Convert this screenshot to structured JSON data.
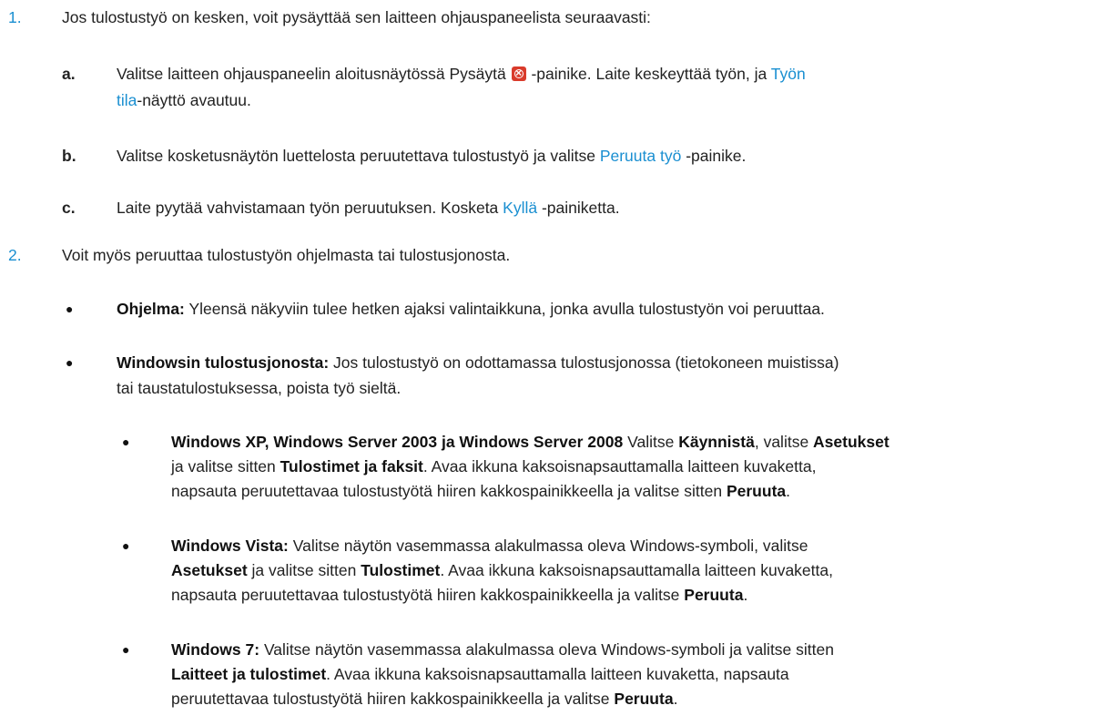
{
  "steps": [
    {
      "num": "1.",
      "text": "Jos tulostustyö on kesken, voit pysäyttää sen laitteen ohjauspaneelista seuraavasti:",
      "substeps": [
        {
          "letter": "a.",
          "line1_before": "Valitse laitteen ohjauspaneelin aloitusnäytössä Pysäytä",
          "icon": "stop-icon",
          "line1_after": "-painike. Laite keskeyttää työn, ja",
          "line1_link": "Työn",
          "line2_link": "tila",
          "line2_after": "-näyttö avautuu."
        },
        {
          "letter": "b.",
          "before": "Valitse kosketusnäytön luettelosta peruutettava tulostustyö ja valitse",
          "link": "Peruuta työ",
          "after": "-painike."
        },
        {
          "letter": "c.",
          "before": "Laite pyytää vahvistamaan työn peruutuksen. Kosketa",
          "link": "Kyllä",
          "after": "-painiketta."
        }
      ]
    },
    {
      "num": "2.",
      "text": "Voit myös peruuttaa tulostustyön ohjelmasta tai tulostusjonosta.",
      "bullets": [
        {
          "bold": "Ohjelma:",
          "text": "Yleensä näkyviin tulee hetken ajaksi valintaikkuna, jonka avulla tulostustyön voi peruuttaa."
        },
        {
          "bold": "Windowsin tulostusjonosta:",
          "line1": "Jos tulostustyö on odottamassa tulostusjonossa (tietokoneen muistissa)",
          "line2": "tai taustatulostuksessa, poista työ sieltä.",
          "subbullets": [
            {
              "bold": "Windows XP, Windows Server 2003 ja Windows Server 2008",
              "t1": "Valitse",
              "b1": "Käynnistä",
              "t2": ", valitse",
              "b2": "Asetukset",
              "t3": "ja valitse sitten",
              "b3": "Tulostimet ja faksit",
              "t4": ". Avaa ikkuna kaksoisnapsauttamalla laitteen kuvaketta,",
              "line3_before": "napsauta peruutettavaa tulostustyötä hiiren kakkospainikkeella ja valitse sitten",
              "line3_bold": "Peruuta",
              "line3_after": "."
            },
            {
              "bold": "Windows Vista:",
              "line1": "Valitse näytön vasemmassa alakulmassa oleva Windows-symboli, valitse",
              "l2_b1": "Asetukset",
              "l2_t1": "ja valitse sitten",
              "l2_b2": "Tulostimet",
              "l2_t2": ". Avaa ikkuna kaksoisnapsauttamalla laitteen kuvaketta,",
              "line3_before": "napsauta peruutettavaa tulostustyötä hiiren kakkospainikkeella ja valitse",
              "line3_bold": "Peruuta",
              "line3_after": "."
            },
            {
              "bold": "Windows 7:",
              "line1": "Valitse näytön vasemmassa alakulmassa oleva Windows-symboli ja valitse sitten",
              "l2_b1": "Laitteet ja tulostimet",
              "l2_t1": ". Avaa ikkuna kaksoisnapsauttamalla laitteen kuvaketta, napsauta",
              "line3_before": "peruutettavaa tulostustyötä hiiren kakkospainikkeella ja valitse",
              "line3_bold": "Peruuta",
              "line3_after": "."
            }
          ]
        }
      ]
    }
  ],
  "bullet_char": "●",
  "colors": {
    "accent": "#1a8fd1",
    "text": "#222222",
    "stop_icon": "#d93b2b"
  }
}
